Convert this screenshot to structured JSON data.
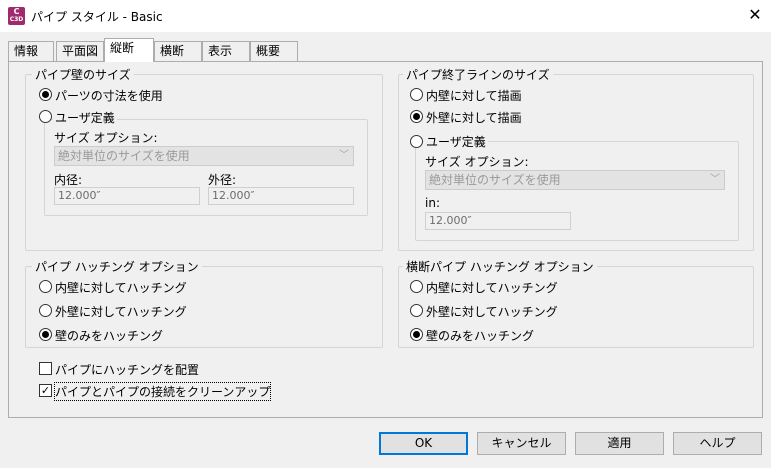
{
  "window": {
    "title": "パイプ スタイル - Basic",
    "icon_label": "C",
    "icon_sub": "C3D"
  },
  "tabs": [
    {
      "label": "情報"
    },
    {
      "label": "平面図"
    },
    {
      "label": "縦断"
    },
    {
      "label": "横断"
    },
    {
      "label": "表示"
    },
    {
      "label": "概要"
    }
  ],
  "active_tab": "縦断",
  "pipe_wall_size": {
    "title": "パイプ壁のサイズ",
    "use_part_dims": "パーツの寸法を使用",
    "user_defined": "ユーザ定義",
    "size_options_label": "サイズ オプション:",
    "size_option_value": "絶対単位のサイズを使用",
    "inner_label": "内径:",
    "inner_value": "12.000″",
    "outer_label": "外径:",
    "outer_value": "12.000″"
  },
  "pipe_end_line_size": {
    "title": "パイプ終了ラインのサイズ",
    "draw_to_inner": "内壁に対して描画",
    "draw_to_outer": "外壁に対して描画",
    "user_defined": "ユーザ定義",
    "size_options_label": "サイズ オプション:",
    "size_option_value": "絶対単位のサイズを使用",
    "in_label": "in:",
    "in_value": "12.000″"
  },
  "pipe_hatch": {
    "title": "パイプ ハッチング オプション",
    "hatch_inner": "内壁に対してハッチング",
    "hatch_outer": "外壁に対してハッチング",
    "hatch_walls_only": "壁のみをハッチング"
  },
  "crossing_pipe_hatch": {
    "title": "横断パイプ ハッチング オプション",
    "hatch_inner": "内壁に対してハッチング",
    "hatch_outer": "外壁に対してハッチング",
    "hatch_walls_only": "壁のみをハッチング"
  },
  "options": {
    "place_hatching": "パイプにハッチングを配置",
    "cleanup_connections": "パイプとパイプの接続をクリーンアップ"
  },
  "buttons": {
    "ok": "OK",
    "cancel": "キャンセル",
    "apply": "適用",
    "help": "ヘルプ"
  }
}
